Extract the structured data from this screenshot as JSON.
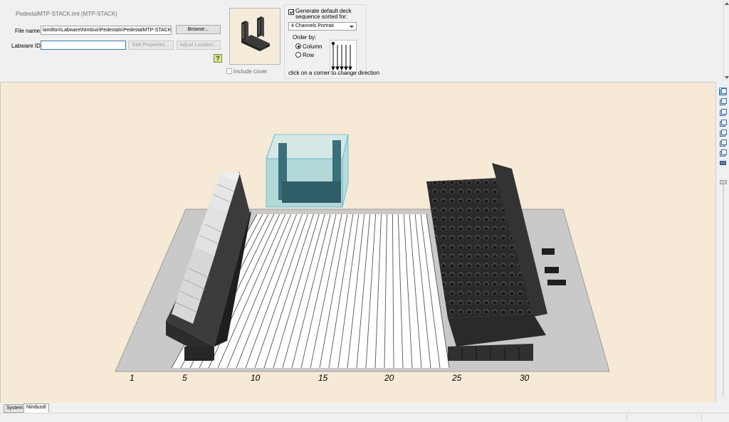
{
  "header": {
    "labware_title": "PedestalMTP-STACK.tml (MTP-STACK)",
    "file_name_label": "File name:",
    "file_name_value": "lamilton\\Labware\\Nimbus\\Pedestals\\PedestalMTP-STACK.tml",
    "browse_label": "Browse...",
    "labware_id_label": "Labware ID:",
    "labware_id_value": "",
    "edit_properties_label": "Edit Properties...",
    "adjust_location_label": "Adjust Location...",
    "include_cover_label": "Include cover"
  },
  "sequence": {
    "generate_label_line1": "Generate default deck",
    "generate_label_line2": "sequence sorted for:",
    "generate_checked": true,
    "channels_selected": "4 Channels Portrait",
    "order_by_label": "Order by:",
    "column_label": "Column",
    "row_label": "Row",
    "selected_order": "Column",
    "hint": "click on a corner to change direction"
  },
  "deck": {
    "track_numbers": [
      "1",
      "5",
      "10",
      "15",
      "20",
      "25",
      "30"
    ]
  },
  "tabs": [
    {
      "label": "System",
      "active": false
    },
    {
      "label": "Nimbus8",
      "active": true
    }
  ],
  "colors": {
    "viewport_bg": "#f6ead6",
    "deck_surface": "#ffffff",
    "highlight_box": "#6fc8dc"
  }
}
